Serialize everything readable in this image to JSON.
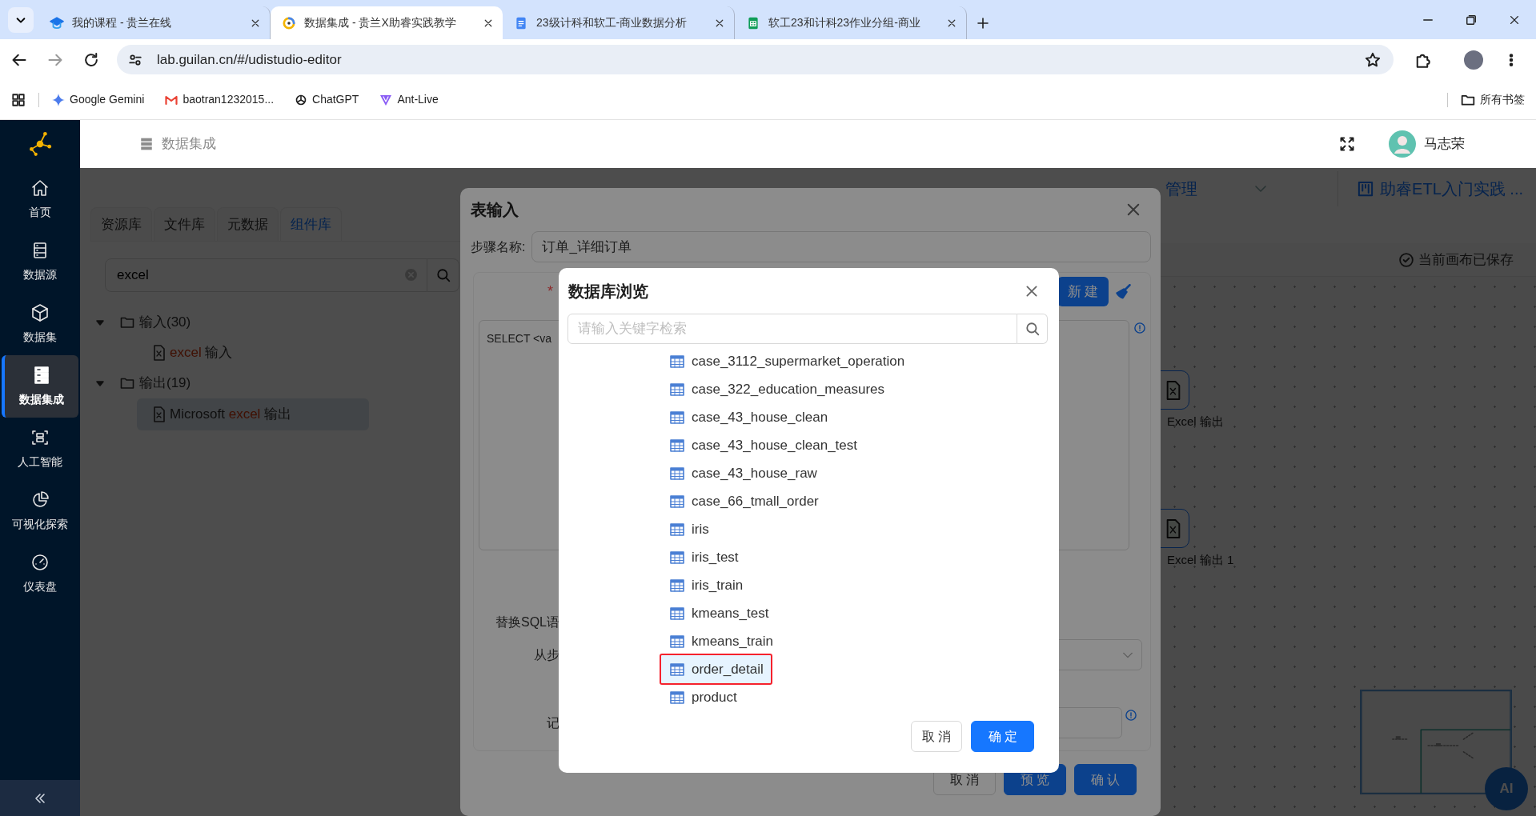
{
  "browser": {
    "tabs": [
      {
        "title": "我的课程 - 贵兰在线",
        "selected": false
      },
      {
        "title": "数据集成 - 贵兰X助睿实践教学",
        "selected": true
      },
      {
        "title": "23级计科和软工-商业数据分析",
        "selected": false
      },
      {
        "title": "软工23和计科23作业分组-商业",
        "selected": false
      }
    ],
    "address": "lab.guilan.cn/#/udistudio-editor",
    "bookmarks": [
      {
        "label": "Google Gemini"
      },
      {
        "label": "baotran1232015..."
      },
      {
        "label": "ChatGPT"
      },
      {
        "label": "Ant-Live"
      }
    ],
    "all_bookmarks": "所有书签"
  },
  "sidebar": {
    "items": [
      {
        "label": "首页",
        "selected": false
      },
      {
        "label": "数据源",
        "selected": false
      },
      {
        "label": "数据集",
        "selected": false
      },
      {
        "label": "数据集成",
        "selected": true
      },
      {
        "label": "人工智能",
        "selected": false
      },
      {
        "label": "可视化探索",
        "selected": false
      },
      {
        "label": "仪表盘",
        "selected": false
      }
    ]
  },
  "header": {
    "breadcrumb": "数据集成",
    "user": "马志荣"
  },
  "workspace": {
    "tabs": [
      {
        "label": "资源库",
        "selected": false
      },
      {
        "label": "文件库",
        "selected": false
      },
      {
        "label": "元数据",
        "selected": false
      },
      {
        "label": "组件库",
        "selected": true
      }
    ],
    "search": {
      "value": "excel"
    },
    "tree": [
      {
        "label": "输入(30)",
        "expanded": true,
        "children": [
          {
            "parts": [
              {
                "text": "excel",
                "highlight": true
              },
              {
                "text": " 输入",
                "highlight": false
              }
            ],
            "selected": false
          }
        ]
      },
      {
        "label": "输出(19)",
        "expanded": true,
        "children": [
          {
            "parts": [
              {
                "text": "Microsoft ",
                "highlight": false
              },
              {
                "text": "excel",
                "highlight": true
              },
              {
                "text": " 输出",
                "highlight": false
              }
            ],
            "selected": true
          }
        ]
      }
    ],
    "nav": [
      "管理"
    ],
    "project_tab": "助睿ETL入门实践 ...",
    "save_status": "当前画布已保存",
    "nodes": [
      {
        "label": "Excel 输出"
      },
      {
        "label": "Excel 输出 1"
      }
    ],
    "ai_button": "AI"
  },
  "table_input_dialog": {
    "title": "表输入",
    "step_name_label": "步骤名称:",
    "step_name": "订单_详细订单",
    "required_mark": "*",
    "new_button": "新建",
    "sql": "SELECT <va",
    "replace_label": "替换SQL语",
    "from_label": "从步",
    "record_label": "记",
    "buttons": [
      {
        "label": "取消",
        "kind": "default"
      },
      {
        "label": "预览",
        "kind": "primary"
      },
      {
        "label": "确认",
        "kind": "primary"
      }
    ]
  },
  "database_browser": {
    "title": "数据库浏览",
    "search": {
      "placeholder": "请输入关键字检索"
    },
    "tables": [
      {
        "name": "case_3112_supermarket_operation",
        "selected": false
      },
      {
        "name": "case_322_education_measures",
        "selected": false
      },
      {
        "name": "case_43_house_clean",
        "selected": false
      },
      {
        "name": "case_43_house_clean_test",
        "selected": false
      },
      {
        "name": "case_43_house_raw",
        "selected": false
      },
      {
        "name": "case_66_tmall_order",
        "selected": false
      },
      {
        "name": "iris",
        "selected": false
      },
      {
        "name": "iris_test",
        "selected": false
      },
      {
        "name": "iris_train",
        "selected": false
      },
      {
        "name": "kmeans_test",
        "selected": false
      },
      {
        "name": "kmeans_train",
        "selected": false
      },
      {
        "name": "order_detail",
        "selected": true
      },
      {
        "name": "product",
        "selected": false
      }
    ],
    "buttons": [
      {
        "label": "取消",
        "kind": "default"
      },
      {
        "label": "确定",
        "kind": "primary"
      }
    ]
  }
}
